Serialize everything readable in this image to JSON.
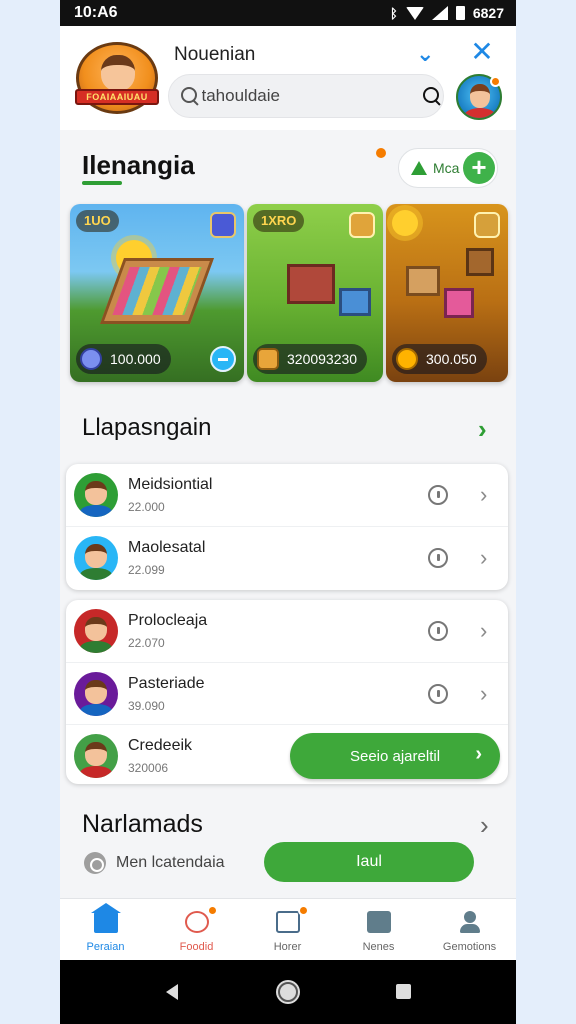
{
  "statusbar": {
    "time": "10:A6",
    "battery_text": "6827"
  },
  "header": {
    "title": "Nouenian",
    "logo_text": "FOAIAAIUAU",
    "search_placeholder": "tahouldaie"
  },
  "featured": {
    "title": "Ilenangia",
    "more_label": "Mca",
    "cards": [
      {
        "badge": "1UO",
        "value": "100.000"
      },
      {
        "badge": "1XRO",
        "value": "320093230"
      },
      {
        "badge": "",
        "value": "300.050"
      }
    ]
  },
  "section1": {
    "title": "Llapasngain",
    "groups": [
      [
        {
          "name": "Meidsiontial",
          "sub": "22.000"
        },
        {
          "name": "Maolesatal",
          "sub": "22.099"
        }
      ],
      [
        {
          "name": "Prolocleaja",
          "sub": "22.070"
        },
        {
          "name": "Pasteriade",
          "sub": "39.090"
        },
        {
          "name": "Credeeik",
          "sub": "320006",
          "action": "Seeio ajareltil"
        }
      ]
    ]
  },
  "section2": {
    "title": "Narlamads",
    "info": "Men lcatendaia",
    "button": "Iaul"
  },
  "bottomnav": [
    {
      "label": "Peraian",
      "icon": "home-icon"
    },
    {
      "label": "Foodid",
      "icon": "gift-icon"
    },
    {
      "label": "Horer",
      "icon": "chat-icon"
    },
    {
      "label": "Nenes",
      "icon": "document-icon"
    },
    {
      "label": "Gemotions",
      "icon": "user-icon"
    }
  ],
  "colors": {
    "accent_green": "#3ea83a",
    "accent_blue": "#1e88e5",
    "badge_orange": "#f57c00"
  }
}
